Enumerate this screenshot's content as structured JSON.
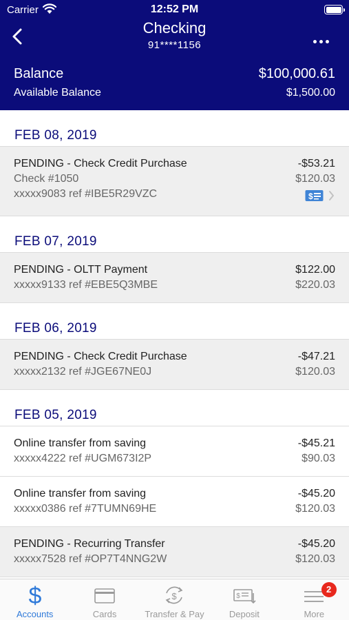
{
  "status_bar": {
    "carrier": "Carrier",
    "time": "12:52 PM"
  },
  "nav": {
    "title": "Checking",
    "account_number": "91****1156"
  },
  "balance": {
    "label": "Balance",
    "value": "$100,000.61",
    "available_label": "Available Balance",
    "available_value": "$1,500.00"
  },
  "groups": [
    {
      "date": "FEB 08, 2019",
      "transactions": [
        {
          "description": "PENDING - Check Credit Purchase",
          "amount": "-$53.21",
          "check": "Check #1050",
          "reference": "xxxxx9083 ref #IBE5R29VZC",
          "balance": "$120.03"
        }
      ]
    },
    {
      "date": "FEB 07, 2019",
      "transactions": [
        {
          "description": "PENDING - OLTT Payment",
          "amount": "$122.00",
          "reference": "xxxxx9133 ref #EBE5Q3MBE",
          "balance": "$220.03"
        }
      ]
    },
    {
      "date": "FEB 06, 2019",
      "transactions": [
        {
          "description": "PENDING - Check Credit Purchase",
          "amount": "-$47.21",
          "reference": "xxxxx2132 ref #JGE67NE0J",
          "balance": "$120.03"
        }
      ]
    },
    {
      "date": "FEB 05, 2019",
      "transactions": [
        {
          "description": "Online transfer from saving",
          "amount": "-$45.21",
          "reference": "xxxxx4222 ref #UGM673I2P",
          "balance": "$90.03"
        },
        {
          "description": "Online transfer from saving",
          "amount": "-$45.20",
          "reference": "xxxxx0386 ref #7TUMN69HE",
          "balance": "$120.03"
        },
        {
          "description": "PENDING - Recurring Transfer",
          "amount": "-$45.20",
          "reference": "xxxxx7528 ref #OP7T4NNG2W",
          "balance": "$120.03"
        }
      ]
    }
  ],
  "tabs": [
    {
      "label": "Accounts",
      "icon": "dollar-icon"
    },
    {
      "label": "Cards",
      "icon": "card-icon"
    },
    {
      "label": "Transfer & Pay",
      "icon": "transfer-icon"
    },
    {
      "label": "Deposit",
      "icon": "deposit-check-icon"
    },
    {
      "label": "More",
      "icon": "menu-icon",
      "badge": "2"
    }
  ],
  "colors": {
    "header": "#0b0c7a",
    "accent": "#2f7ad9",
    "badge": "#e8281d",
    "pending_row": "#efefef"
  }
}
